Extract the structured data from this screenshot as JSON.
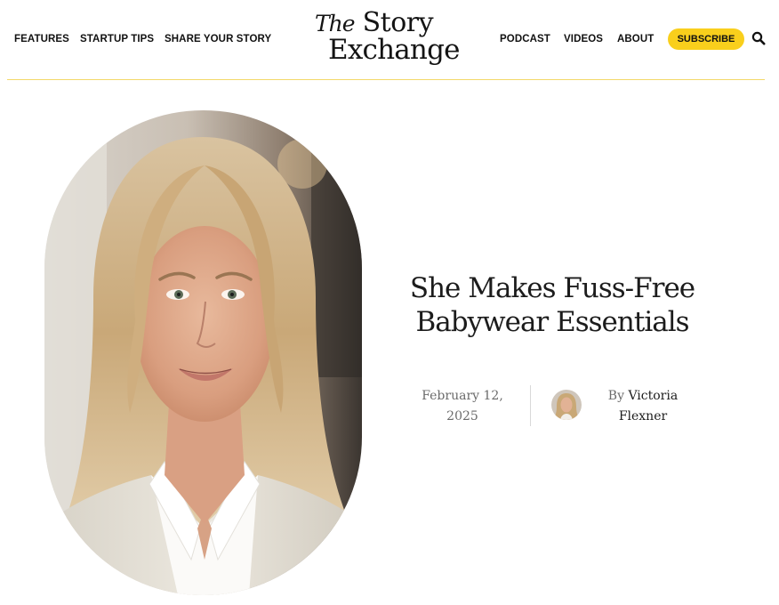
{
  "header": {
    "nav_left": [
      "FEATURES",
      "STARTUP TIPS",
      "SHARE YOUR STORY"
    ],
    "logo": {
      "line1_prefix": "The",
      "line1_word": "Story",
      "line2": "Exchange"
    },
    "nav_right": [
      "PODCAST",
      "VIDEOS",
      "ABOUT"
    ],
    "subscribe_label": "SUBSCRIBE",
    "search_icon": "search-icon",
    "accent_color": "#f9cf1c"
  },
  "article": {
    "headline_line1": "She Makes Fuss-Free",
    "headline_line2": "Babywear Essentials",
    "date_line1": "February 12,",
    "date_line2": "2025",
    "byline_prefix": "By",
    "author_first": "Victoria",
    "author_last": "Flexner"
  }
}
